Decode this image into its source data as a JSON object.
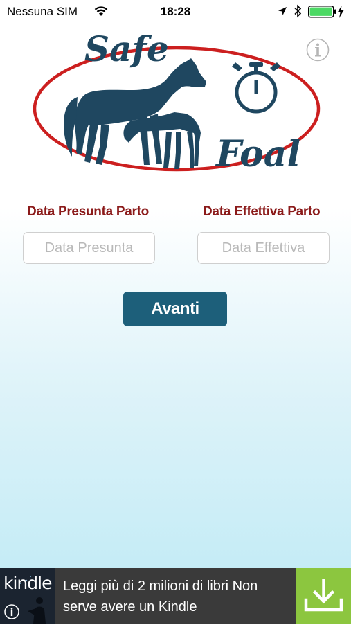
{
  "status_bar": {
    "carrier": "Nessuna SIM",
    "time": "18:28",
    "battery_color": "#4cd964"
  },
  "logo": {
    "word_top": "Safe",
    "word_bottom": "Foal",
    "colors": {
      "ring": "#cc1f1f",
      "horse": "#1f4760"
    }
  },
  "form": {
    "presunta_label": "Data Presunta Parto",
    "effettiva_label": "Data Effettiva Parto",
    "presunta_placeholder": "Data Presunta",
    "effettiva_placeholder": "Data Effettiva",
    "submit_label": "Avanti"
  },
  "ad": {
    "brand": "kindle",
    "text": "Leggi più di 2 milioni di libri Non serve avere un Kindle",
    "accent_color": "#8cc63f"
  },
  "icons": [
    "wifi-icon",
    "location-icon",
    "bluetooth-icon",
    "battery-icon",
    "charging-icon",
    "info-icon",
    "stopwatch-icon",
    "horse-icon",
    "download-icon"
  ]
}
